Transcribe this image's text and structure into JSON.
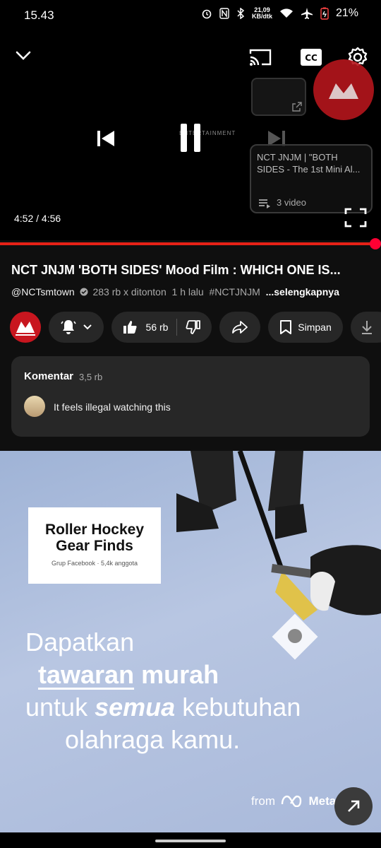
{
  "status_bar": {
    "time": "15.43",
    "net_speed_value": "21,09",
    "net_speed_unit": "KB/dtk",
    "battery_percent": "21%"
  },
  "player": {
    "timecode": "4:52 / 4:56",
    "progress_fraction": 0.985,
    "watermark_text": "ENTERTAINMENT",
    "playlist_card_title": "NCT JNJM | \"BOTH SIDES - The 1st Mini Al...",
    "playlist_card_count": "3 video"
  },
  "video": {
    "title": "NCT JNJM 'BOTH SIDES' Mood Film : WHICH ONE IS...",
    "channel": "@NCTsmtown",
    "views": "283 rb x ditonton",
    "age": "1 h lalu",
    "hashtag": "#NCTJNJM",
    "more": "...selengkapnya"
  },
  "actions": {
    "likes": "56 rb",
    "save_label": "Simpan"
  },
  "comments": {
    "heading": "Komentar",
    "count": "3,5 rb",
    "top_comment": "It feels illegal watching this"
  },
  "ad": {
    "card_title": "Roller Hockey Gear Finds",
    "card_subtitle": "Grup Facebook · 5,4k anggota",
    "line1": "Dapatkan",
    "line2_a": "tawaran",
    "line2_b": "murah",
    "line3_a": "untuk",
    "line3_b": "semua",
    "line3_c": "kebutuhan",
    "line4": "olahraga kamu.",
    "from_label": "from",
    "brand": "Meta"
  },
  "colors": {
    "accent_red": "#ff0033",
    "surface": "#272727",
    "background": "#0f0f0f"
  }
}
